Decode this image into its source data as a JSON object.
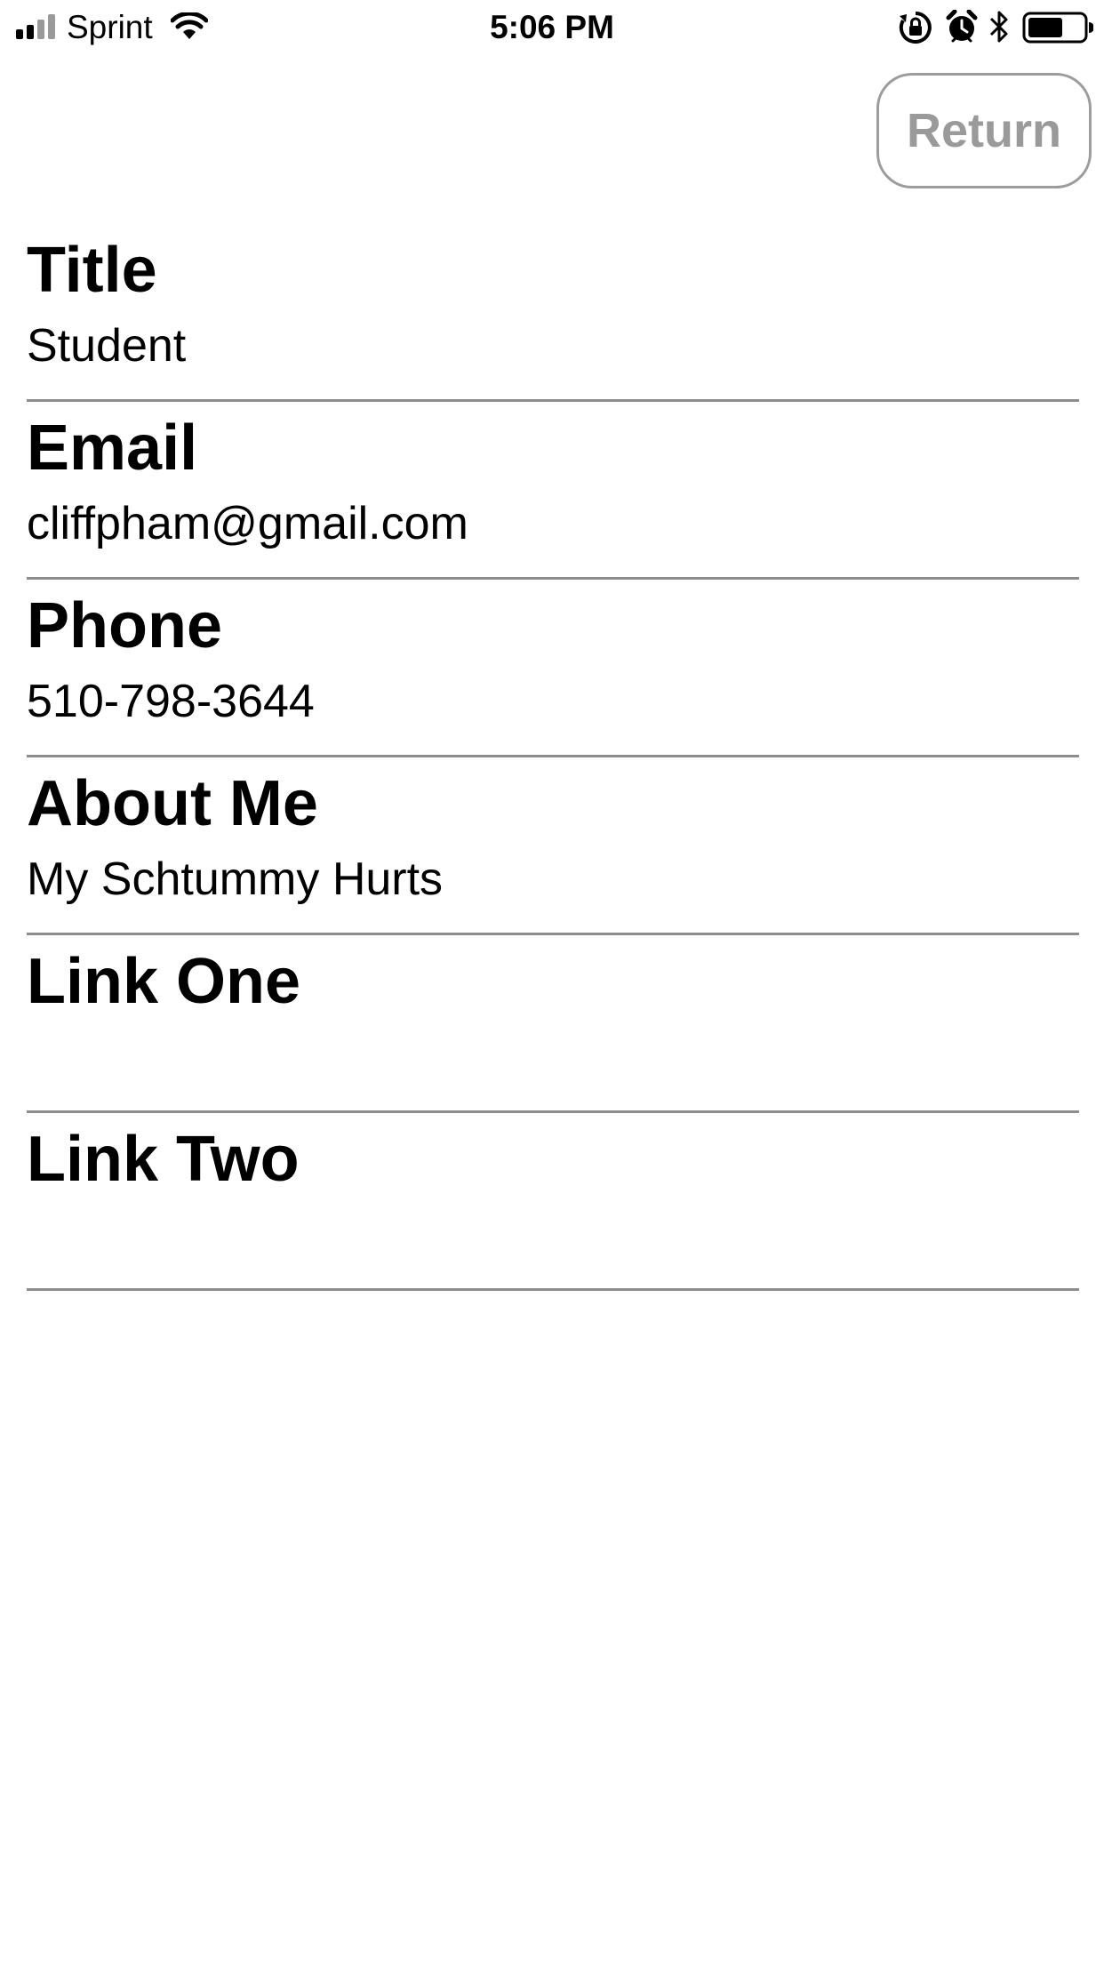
{
  "status_bar": {
    "carrier": "Sprint",
    "time": "5:06 PM",
    "icons": [
      "signal-icon",
      "wifi-icon",
      "rotation-lock-icon",
      "alarm-icon",
      "bluetooth-icon",
      "battery-icon"
    ]
  },
  "header": {
    "return_label": "Return"
  },
  "fields": [
    {
      "label": "Title",
      "value": "Student"
    },
    {
      "label": "Email",
      "value": "cliffpham@gmail.com"
    },
    {
      "label": "Phone",
      "value": "510-798-3644"
    },
    {
      "label": "About Me",
      "value": "My Schtummy Hurts"
    },
    {
      "label": "Link One",
      "value": ""
    },
    {
      "label": "Link Two",
      "value": ""
    }
  ],
  "colors": {
    "text": "#000000",
    "button_border": "#9c9c9c",
    "button_text": "#9a9a9a",
    "divider": "#8c8c8c",
    "background": "#ffffff"
  }
}
